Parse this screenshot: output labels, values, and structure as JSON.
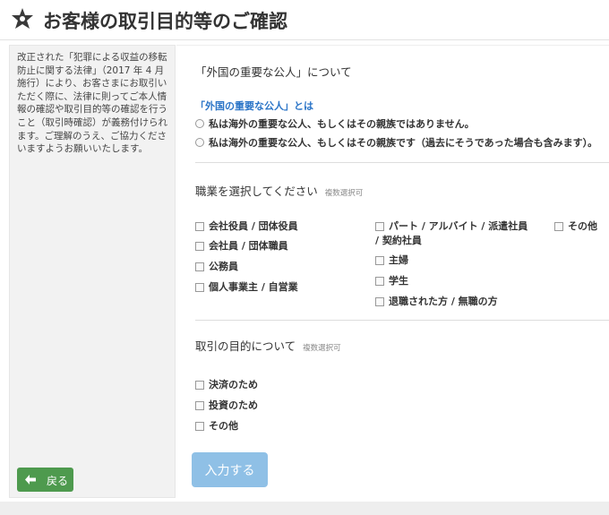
{
  "header": {
    "title": "お客様の取引目的等のご確認",
    "icon": "star-badge-icon"
  },
  "sidebar": {
    "note": "改正された「犯罪による収益の移転防止に関する法律」（2017 年 4 月施行）により、お客さまにお取引いただく際に、法律に則ってご本人情報の確認や取引目的等の確認を行うこと（取引時確認）が義務付けられます。ご理解のうえ、ご協力くださいますようお願いいたします。",
    "back_label": "戻る"
  },
  "pep": {
    "title": "「外国の重要な公人」について",
    "link": "「外国の重要な公人」とは",
    "options": [
      "私は海外の重要な公人、もしくはその親族ではありません。",
      "私は海外の重要な公人、もしくはその親族です（過去にそうであった場合も含みます）。"
    ]
  },
  "occupation": {
    "title": "職業を選択してください",
    "note": "複数選択可",
    "col1": [
      "会社役員 / 団体役員",
      "会社員 / 団体職員",
      "公務員",
      "個人事業主 / 自営業"
    ],
    "col2_line1": "パート / アルバイト / 派遣社員",
    "col2_line2": "/ 契約社員",
    "col2": [
      "主婦",
      "学生",
      "退職された方 / 無職の方"
    ],
    "col3": [
      "その他"
    ]
  },
  "purpose": {
    "title": "取引の目的について",
    "note": "複数選択可",
    "options": [
      "決済のため",
      "投資のため",
      "その他"
    ]
  },
  "submit_label": "入力する",
  "colors": {
    "back_button": "#4e9a4e",
    "submit_button": "#8fc0e6",
    "link": "#2a74c7"
  }
}
